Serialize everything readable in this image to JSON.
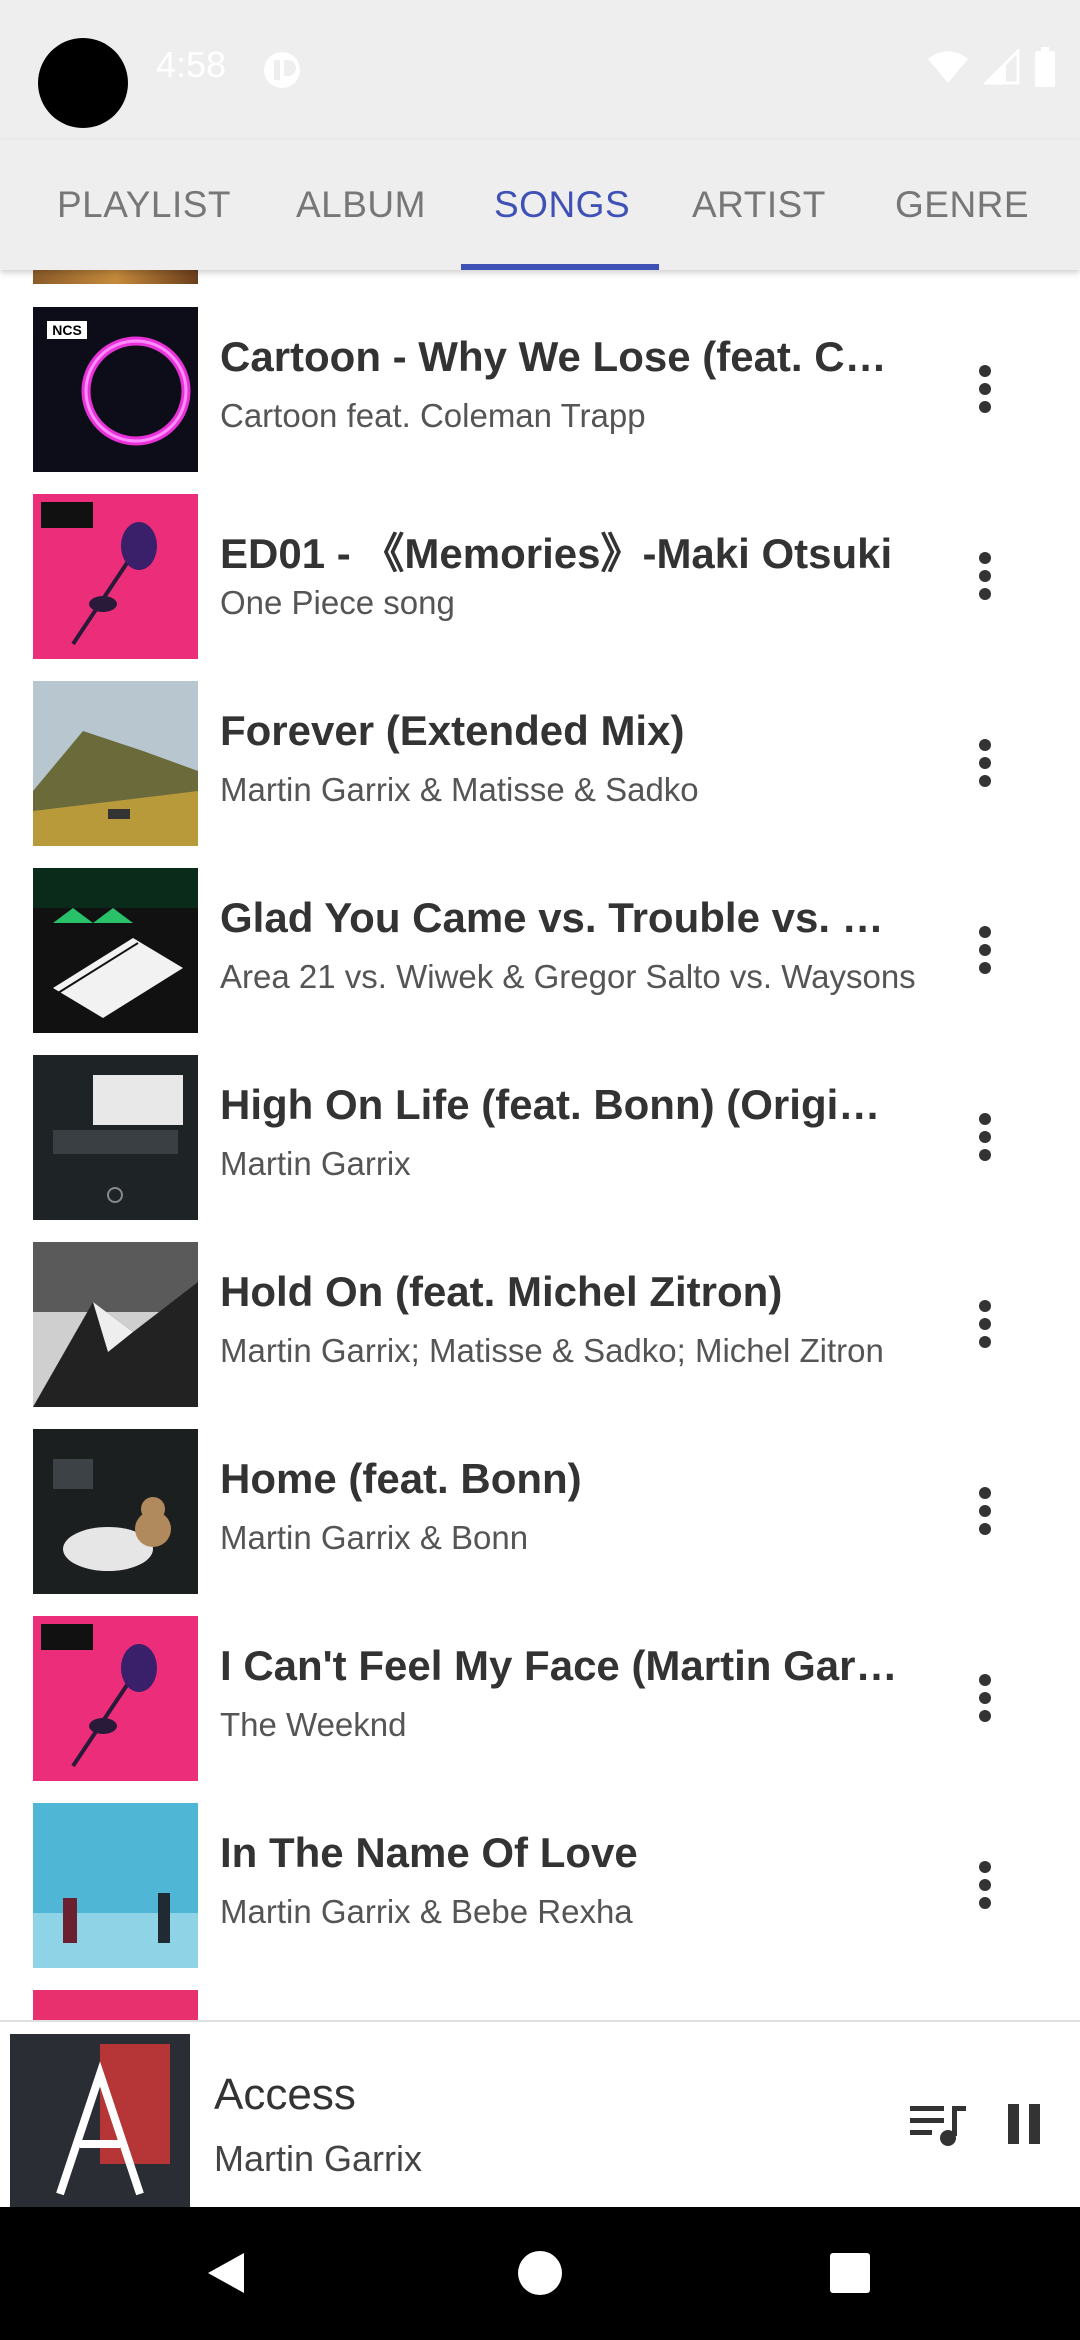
{
  "status_bar": {
    "time": "4:58"
  },
  "tabs": [
    {
      "label": "PLAYLIST",
      "active": false
    },
    {
      "label": "ALBUM",
      "active": false
    },
    {
      "label": "SONGS",
      "active": true
    },
    {
      "label": "ARTIST",
      "active": false
    },
    {
      "label": "GENRE",
      "active": false
    }
  ],
  "accent_color": "#3f51b5",
  "songs": [
    {
      "title": "Cartoon - Why We Lose (feat. Co…",
      "artist": "Cartoon feat. Coleman Trapp",
      "art": "ncs-ring"
    },
    {
      "title": "ED01 - 《Memories》-Maki Otsuki",
      "artist": "One Piece song",
      "art": "pink-rose"
    },
    {
      "title": "Forever (Extended Mix)",
      "artist": "Martin Garrix & Matisse & Sadko",
      "art": "mountain-landscape"
    },
    {
      "title": "Glad You Came vs. Trouble vs. H…",
      "artist": "Area 21 vs. Wiwek & Gregor Salto vs. Waysons",
      "art": "homeland-piano"
    },
    {
      "title": "High On Life (feat. Bonn) (Origin…",
      "artist": "Martin Garrix",
      "art": "high-dark"
    },
    {
      "title": "Hold On (feat. Michel Zitron)",
      "artist": "Martin Garrix; Matisse & Sadko; Michel Zitron",
      "art": "hold-on-mountain"
    },
    {
      "title": "Home (feat. Bonn)",
      "artist": "Martin Garrix & Bonn",
      "art": "home-bathtub"
    },
    {
      "title": "I Can't Feel My Face (Martin Garr…",
      "artist": "The Weeknd",
      "art": "pink-rose"
    },
    {
      "title": "In The Name Of Love",
      "artist": "Martin Garrix & Bebe Rexha",
      "art": "blue-couple"
    }
  ],
  "now_playing": {
    "title": "Access",
    "artist": "Martin Garrix"
  },
  "icons": {
    "more": "more-vert-icon",
    "queue": "queue-music-icon",
    "pause": "pause-icon",
    "back": "nav-back-icon",
    "home": "nav-home-icon",
    "recents": "nav-recents-icon"
  }
}
